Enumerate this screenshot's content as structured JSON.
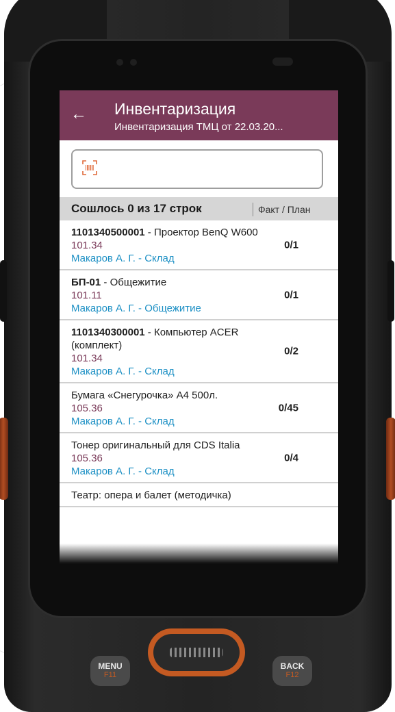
{
  "app": {
    "title": "Инвентаризация",
    "subtitle": "Инвентаризация ТМЦ от 22.03.20...",
    "back_icon": "arrow-left-icon",
    "accent_color": "#7a3a59",
    "link_color": "#1b8fc4"
  },
  "scanner": {
    "icon": "barcode-scan-icon",
    "value": ""
  },
  "summary": {
    "matched_text": "Сошлось 0 из 17 строк",
    "column_label": "Факт / План"
  },
  "items": [
    {
      "code": "1101340500001",
      "name": " - Проектор BenQ W600",
      "account": "101.34",
      "location": "Макаров А. Г. - Склад",
      "qty": "0/1"
    },
    {
      "code": "БП-01",
      "name": " - Общежитие",
      "account": "101.11",
      "location": "Макаров А. Г. - Общежитие",
      "qty": "0/1"
    },
    {
      "code": "1101340300001",
      "name": " - Компьютер ACER (комплект)",
      "account": "101.34",
      "location": "Макаров А. Г. - Склад",
      "qty": "0/2"
    },
    {
      "code": "",
      "name": "Бумага «Снегурочка» А4 500л.",
      "account": "105.36",
      "location": "Макаров А. Г. - Склад",
      "qty": "0/45"
    },
    {
      "code": "",
      "name": "Тонер оригинальный для CDS Italia",
      "account": "105.36",
      "location": "Макаров А. Г. - Склад",
      "qty": "0/4"
    },
    {
      "code": "",
      "name": "Театр: опера и балет (методичка)",
      "account": "",
      "location": "",
      "qty": ""
    }
  ],
  "keys": {
    "menu_label": "MENU",
    "menu_fn": "F11",
    "back_label": "BACK",
    "back_fn": "F12"
  }
}
